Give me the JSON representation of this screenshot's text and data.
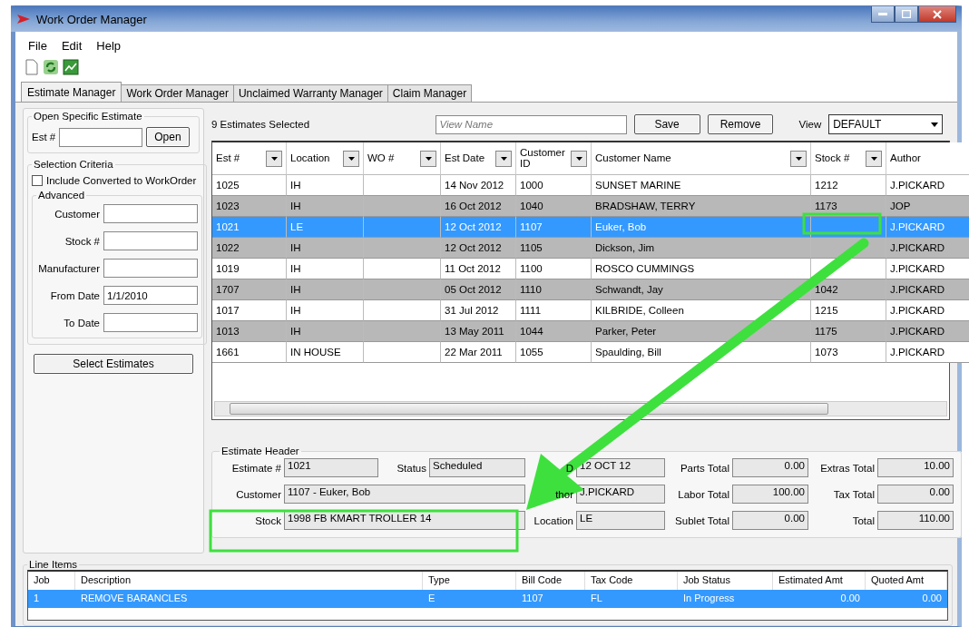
{
  "window": {
    "title": "Work Order Manager"
  },
  "menu": [
    "File",
    "Edit",
    "Help"
  ],
  "tabs": [
    {
      "label": "Estimate Manager",
      "selected": true
    },
    {
      "label": "Work Order Manager",
      "selected": false
    },
    {
      "label": "Unclaimed Warranty Manager",
      "selected": false
    },
    {
      "label": "Claim Manager",
      "selected": false
    }
  ],
  "open_estimate": {
    "title": "Open Specific Estimate",
    "label": "Est #",
    "button": "Open"
  },
  "selection_criteria": {
    "title": "Selection Criteria",
    "checkbox": {
      "label": "Include Converted to WorkOrder",
      "checked": false
    },
    "advanced": {
      "title": "Advanced",
      "fields": [
        {
          "label": "Customer"
        },
        {
          "label": "Stock #"
        },
        {
          "label": "Manufacturer"
        },
        {
          "label": "From Date",
          "value": "1/1/2010"
        },
        {
          "label": "To Date"
        }
      ]
    }
  },
  "select_button": "Select Estimates",
  "estimates": {
    "count": "9 Estimates Selected",
    "view_name": {
      "placeholder": "View Name"
    },
    "buttons": [
      "Save",
      "Remove"
    ],
    "view_label": "View",
    "view_value": "DEFAULT",
    "columns": [
      {
        "label": "Est #",
        "filter": true
      },
      {
        "label": "Location",
        "filter": true
      },
      {
        "label": "WO #",
        "filter": true
      },
      {
        "label": "Est Date",
        "filter": true
      },
      {
        "label": "Customer ID",
        "filter": true
      },
      {
        "label": "Customer Name",
        "filter": true
      },
      {
        "label": "Stock #",
        "filter": true
      },
      {
        "label": "Author",
        "filter": false
      }
    ],
    "rows": [
      {
        "cells": [
          "1025",
          "IH",
          "",
          "14 Nov 2012",
          "1000",
          "SUNSET MARINE",
          "1212",
          "J.PICKARD"
        ],
        "selected": false
      },
      {
        "cells": [
          "1023",
          "IH",
          "",
          "16 Oct 2012",
          "1040",
          "BRADSHAW, TERRY",
          "1173",
          "JOP"
        ],
        "selected": false
      },
      {
        "cells": [
          "1021",
          "LE",
          "",
          "12 Oct 2012",
          "1107",
          "Euker, Bob",
          "",
          "J.PICKARD"
        ],
        "selected": true
      },
      {
        "cells": [
          "1022",
          "IH",
          "",
          "12 Oct 2012",
          "1105",
          "Dickson, Jim",
          "",
          "J.PICKARD"
        ],
        "selected": false
      },
      {
        "cells": [
          "1019",
          "IH",
          "",
          "11 Oct 2012",
          "1100",
          "ROSCO CUMMINGS",
          "",
          "J.PICKARD"
        ],
        "selected": false
      },
      {
        "cells": [
          "1707",
          "IH",
          "",
          "05 Oct 2012",
          "1110",
          "Schwandt, Jay",
          "1042",
          "J.PICKARD"
        ],
        "selected": false
      },
      {
        "cells": [
          "1017",
          "IH",
          "",
          "31 Jul 2012",
          "1111",
          "KILBRIDE, Colleen",
          "1215",
          "J.PICKARD"
        ],
        "selected": false
      },
      {
        "cells": [
          "1013",
          "IH",
          "",
          "13 May 2011",
          "1044",
          "Parker, Peter",
          "1175",
          "J.PICKARD"
        ],
        "selected": false
      },
      {
        "cells": [
          "1661",
          "IN HOUSE",
          "",
          "22 Mar 2011",
          "1055",
          "Spaulding, Bill",
          "1073",
          "J.PICKARD"
        ],
        "selected": false
      }
    ]
  },
  "estimate_header": {
    "title": "Estimate Header",
    "sections": [
      {
        "fields": [
          {
            "label": "Estimate #",
            "value": "1021",
            "kind": "text"
          },
          {
            "label": "Status",
            "value": "Scheduled",
            "kind": "text"
          },
          {
            "label": "Customer",
            "value": "1107 - Euker, Bob",
            "kind": "wide"
          },
          {
            "label": "Stock",
            "value": "1998 FB KMART TROLLER 14",
            "kind": "wide"
          }
        ]
      },
      {
        "fields": [
          {
            "label": "D",
            "value": "12 OCT 12",
            "kind": "text"
          },
          {
            "label": "thor",
            "value": "J.PICKARD",
            "kind": "text"
          },
          {
            "label": "Location",
            "value": "LE",
            "kind": "text"
          }
        ]
      },
      {
        "fields": [
          {
            "label": "Parts Total",
            "value": "0.00",
            "kind": "amount"
          },
          {
            "label": "Extras Total",
            "value": "10.00",
            "kind": "amount"
          },
          {
            "label": "Labor Total",
            "value": "100.00",
            "kind": "amount"
          },
          {
            "label": "Tax Total",
            "value": "0.00",
            "kind": "amount"
          },
          {
            "label": "Sublet Total",
            "value": "0.00",
            "kind": "amount"
          },
          {
            "label": "Total",
            "value": "110.00",
            "kind": "amount"
          }
        ]
      }
    ]
  },
  "line_items": {
    "title": "Line Items",
    "columns": [
      "Job",
      "Description",
      "Type",
      "Bill Code",
      "Tax Code",
      "Job Status",
      "Estimated Amt",
      "Quoted Amt"
    ],
    "rows": [
      {
        "cells": [
          "1",
          "REMOVE BARANCLES",
          "E",
          "1107",
          "FL",
          "In Progress",
          "0.00",
          "0.00"
        ],
        "selected": true
      }
    ]
  }
}
